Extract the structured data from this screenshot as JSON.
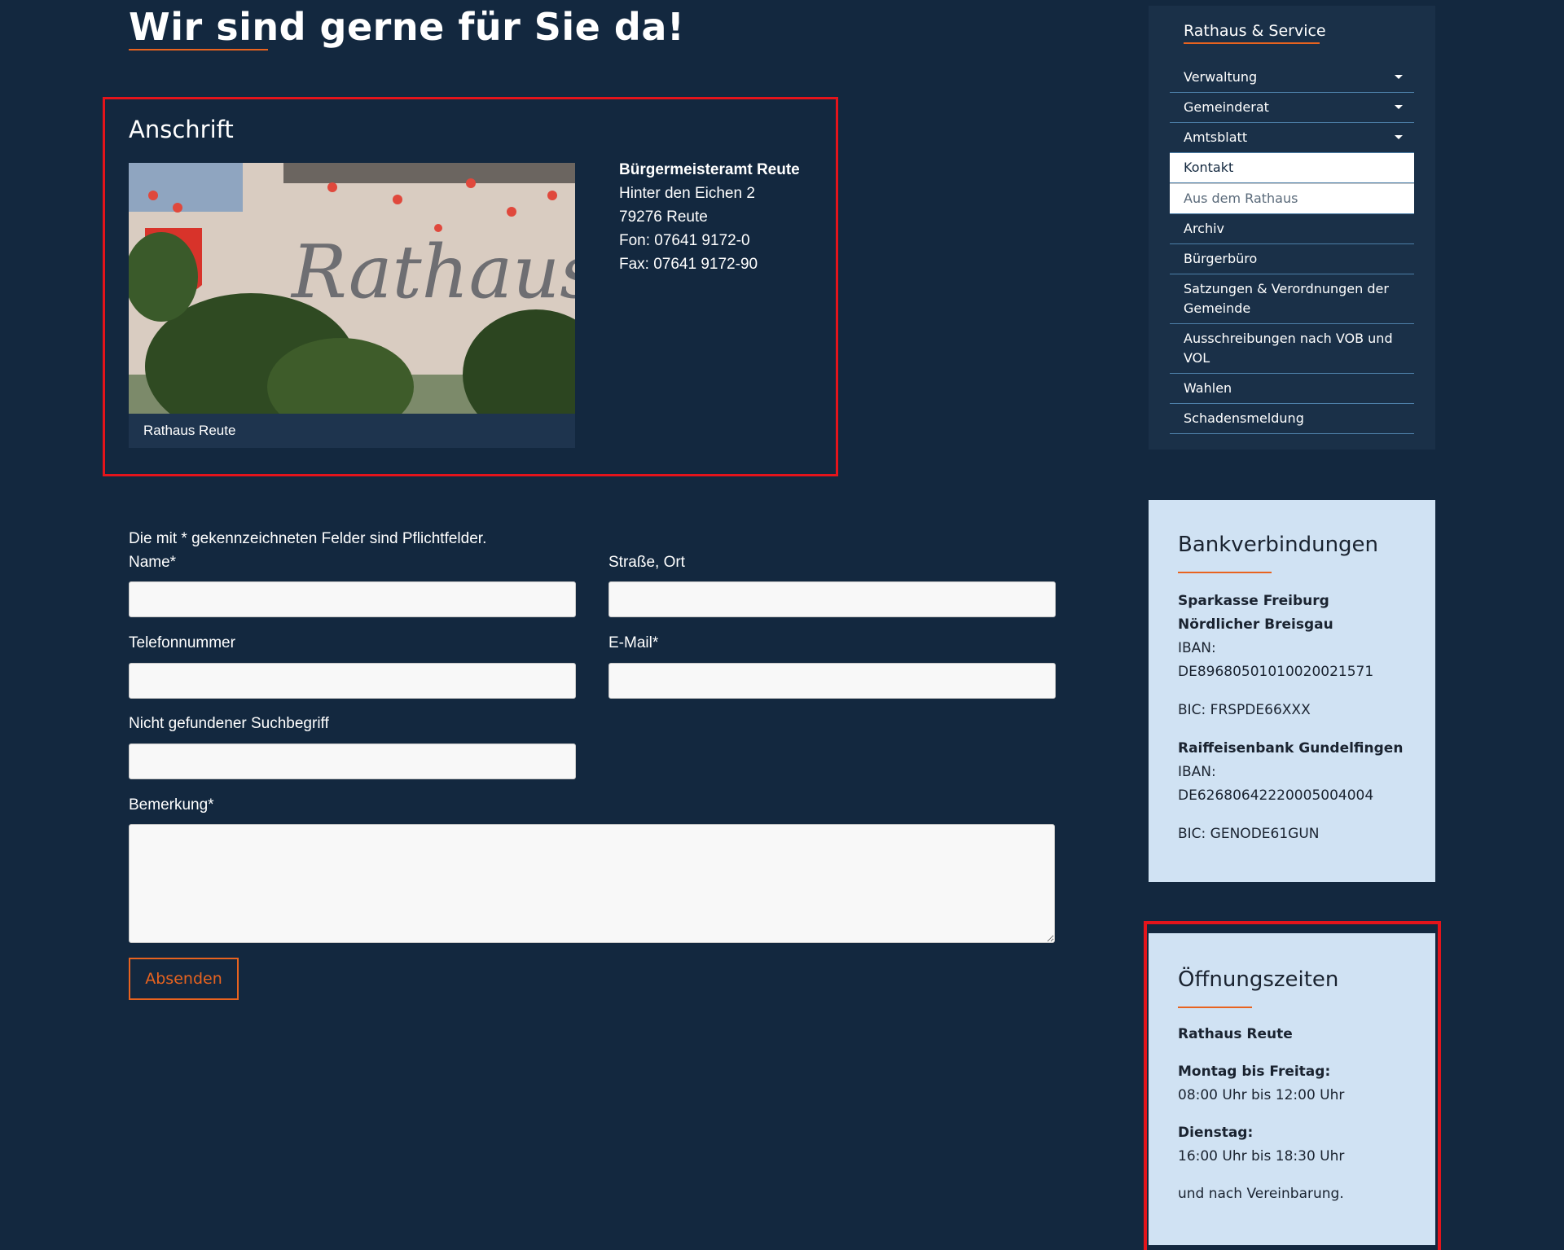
{
  "page": {
    "title": "Wir sind gerne für Sie da!"
  },
  "anschrift": {
    "heading": "Anschrift",
    "image_caption": "Rathaus Reute",
    "address": {
      "name": "Bürgermeisteramt Reute",
      "street": "Hinter den Eichen 2",
      "city": "79276 Reute",
      "phone": "Fon: 07641 9172-0",
      "fax": "Fax: 07641 9172-90"
    }
  },
  "form": {
    "note": "Die mit * gekennzeichneten Felder sind Pflichtfelder.",
    "name_label": "Name*",
    "street_label": "Straße, Ort",
    "phone_label": "Telefonnummer",
    "email_label": "E-Mail*",
    "search_label": "Nicht gefundener Suchbegriff",
    "remark_label": "Bemerkung*",
    "submit_label": "Absenden"
  },
  "sidebar": {
    "title": "Rathaus & Service",
    "items": [
      {
        "label": "Verwaltung"
      },
      {
        "label": "Gemeinderat"
      },
      {
        "label": "Amtsblatt"
      },
      {
        "label": "Kontakt"
      },
      {
        "label": "Aus dem Rathaus"
      },
      {
        "label": "Archiv"
      },
      {
        "label": "Bürgerbüro"
      },
      {
        "label": "Satzungen & Verordnungen der Gemeinde"
      },
      {
        "label": "Ausschreibungen nach VOB und VOL"
      },
      {
        "label": "Wahlen"
      },
      {
        "label": "Schadensmeldung"
      }
    ]
  },
  "bank": {
    "heading": "Bankverbindungen",
    "bank1_name": "Sparkasse Freiburg Nördlicher Breisgau",
    "bank1_iban_label": "IBAN:",
    "bank1_iban": "DE89680501010020021571",
    "bank1_bic": "BIC: FRSPDE66XXX",
    "bank2_name": "Raiffeisenbank Gundelfingen",
    "bank2_iban_label": "IBAN:",
    "bank2_iban": "DE62680642220005004004",
    "bank2_bic": "BIC: GENODE61GUN"
  },
  "hours": {
    "heading": "Öffnungszeiten",
    "place": "Rathaus Reute",
    "day1": "Montag bis Freitag:",
    "time1": "08:00 Uhr bis 12:00 Uhr",
    "day2": "Dienstag:",
    "time2": "16:00 Uhr bis 18:30 Uhr",
    "note": "und nach Vereinbarung."
  },
  "colors": {
    "background": "#13283f",
    "accent": "#e8631f",
    "highlight_frame": "#e4141b",
    "infobox": "#d0e2f3"
  }
}
